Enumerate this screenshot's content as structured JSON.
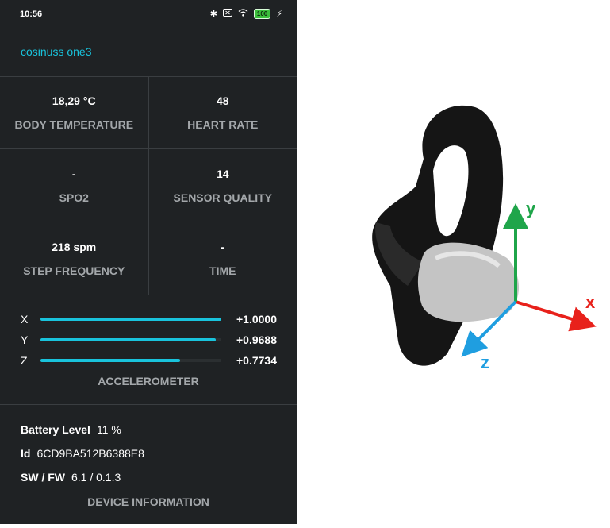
{
  "status_bar": {
    "time": "10:56",
    "battery": "100"
  },
  "device": {
    "name": "cosinuss one3"
  },
  "metrics": [
    {
      "value": "18,29 °C",
      "label": "BODY TEMPERATURE"
    },
    {
      "value": "48",
      "label": "HEART RATE"
    },
    {
      "value": "-",
      "label": "SPO2"
    },
    {
      "value": "14",
      "label": "SENSOR QUALITY"
    },
    {
      "value": "218 spm",
      "label": "STEP FREQUENCY"
    },
    {
      "value": "-",
      "label": "TIME"
    }
  ],
  "accelerometer": {
    "label": "ACCELEROMETER",
    "axes": [
      {
        "name": "X",
        "value": "+1.0000",
        "level": 1.0
      },
      {
        "name": "Y",
        "value": "+0.9688",
        "level": 0.9688
      },
      {
        "name": "Z",
        "value": "+0.7734",
        "level": 0.7734
      }
    ],
    "bar_color": "#19c3dc"
  },
  "device_info": {
    "section_label": "DEVICE INFORMATION",
    "battery_key": "Battery Level",
    "battery_value": "11 %",
    "id_key": "Id",
    "id_value": "6CD9BA512B6388E8",
    "fw_key": "SW / FW",
    "fw_value": "6.1 / 0.1.3"
  },
  "photo_axes": {
    "x_label": "x",
    "x_color": "#e8211b",
    "y_label": "y",
    "y_color": "#1fa54a",
    "z_label": "z",
    "z_color": "#1f9ee0"
  }
}
